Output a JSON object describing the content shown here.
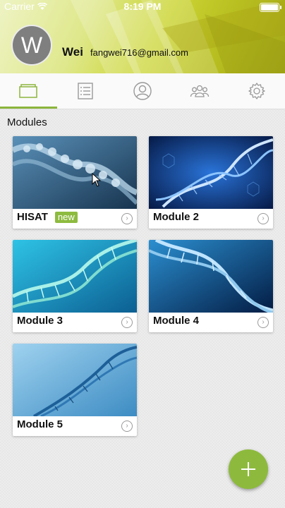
{
  "status_bar": {
    "carrier": "Carrier",
    "time": "8:19 PM"
  },
  "user": {
    "avatar_initial": "W",
    "name": "Wei",
    "email": "fangwei716@gmail.com"
  },
  "tabs": [
    {
      "icon": "folder-icon",
      "active": true
    },
    {
      "icon": "list-icon",
      "active": false
    },
    {
      "icon": "person-icon",
      "active": false
    },
    {
      "icon": "group-icon",
      "active": false
    },
    {
      "icon": "gear-icon",
      "active": false
    }
  ],
  "section_title": "Modules",
  "modules": [
    {
      "title": "HISAT",
      "badge": "new"
    },
    {
      "title": "Module 2"
    },
    {
      "title": "Module 3"
    },
    {
      "title": "Module 4"
    },
    {
      "title": "Module 5"
    }
  ],
  "colors": {
    "accent": "#8dba3c",
    "header": "#c9d32f"
  }
}
